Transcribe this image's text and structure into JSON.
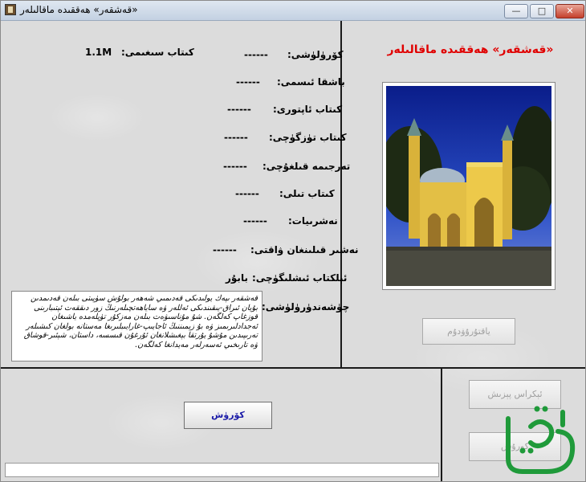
{
  "window": {
    "title": "«قەشقەر» ھەققىدە ماقالىلەر",
    "minimize": "—",
    "maximize": "□",
    "close": "✕"
  },
  "details": {
    "size_label": "كىتاب سىغىمى:",
    "size_value": "1.1M",
    "view_label": "كۆرۈلۈشى:",
    "view_value": "------",
    "title_label": "باشقا ئىسمى:",
    "title_value": "------",
    "author_label": "كىتاب ئاپتورى:",
    "author_value": "------",
    "editor_label": "كىتاب تۈزگۈچى:",
    "editor_value": "------",
    "translator_label": "تەرجىمە قىلغۇچى:",
    "translator_value": "------",
    "language_label": "كىتاب تىلى:",
    "language_value": "------",
    "publisher_label": "نەشرىيات:",
    "publisher_value": "------",
    "pubdate_label": "نەشىر قىلىنغان ۋاقتى:",
    "pubdate_value": "------",
    "ebook_maker_label": "ئېلكتاب ئىشلىگۈچى:",
    "ebook_maker_value": "بابۇر",
    "intro_label": "چۈشەندۈرۈلۈشى:"
  },
  "description": "قەشقەر ىپەك يولىدىكى قەدىمىي شەھەر بولۇش سۈپىتى بىلەن قەدىمدىن بۇيان ئىراق-يىقىندىكى ئەللەر ۋە ساياھەتچىلەرنىڭ زور دىققەت ئېتىبارىنى قوزغاپ كەلگەن. شۇ مۇناسىۋەت بىلەن مەزكۇر تۈپلەمدە ياشىغان ئەجدادلىرىمىز ۋە بۇ زېمىننىڭ ئاجايىپ-غارايىبلىرىغا مەستانە بولغان كىشىلەر تەرىپىدىن مۇشۇ يۇرتقا بېغىشلانغان ئۇرغۇن قىسسە، داستان، شېئىر-قوشاق ۋە تارىخىي ئەسەرلەر مەيدانغا كەلگەن.",
  "heading": "«قەشقەر» ھەققىدە ماقالىلەر",
  "buttons": {
    "read": "كۆرۈش",
    "bookmark": "ياقتۇرۇۋدۇم",
    "resize": "ئېكراس پېزىش",
    "other": "كورۇش"
  },
  "colors": {
    "heading": "#e00000",
    "read_button_text": "#1a1aa8",
    "logo_green": "#1f9a3a"
  },
  "icons": {
    "app": "book-icon",
    "photo": "mosque-photo",
    "logo": "uyghur-calligraphy-logo"
  }
}
